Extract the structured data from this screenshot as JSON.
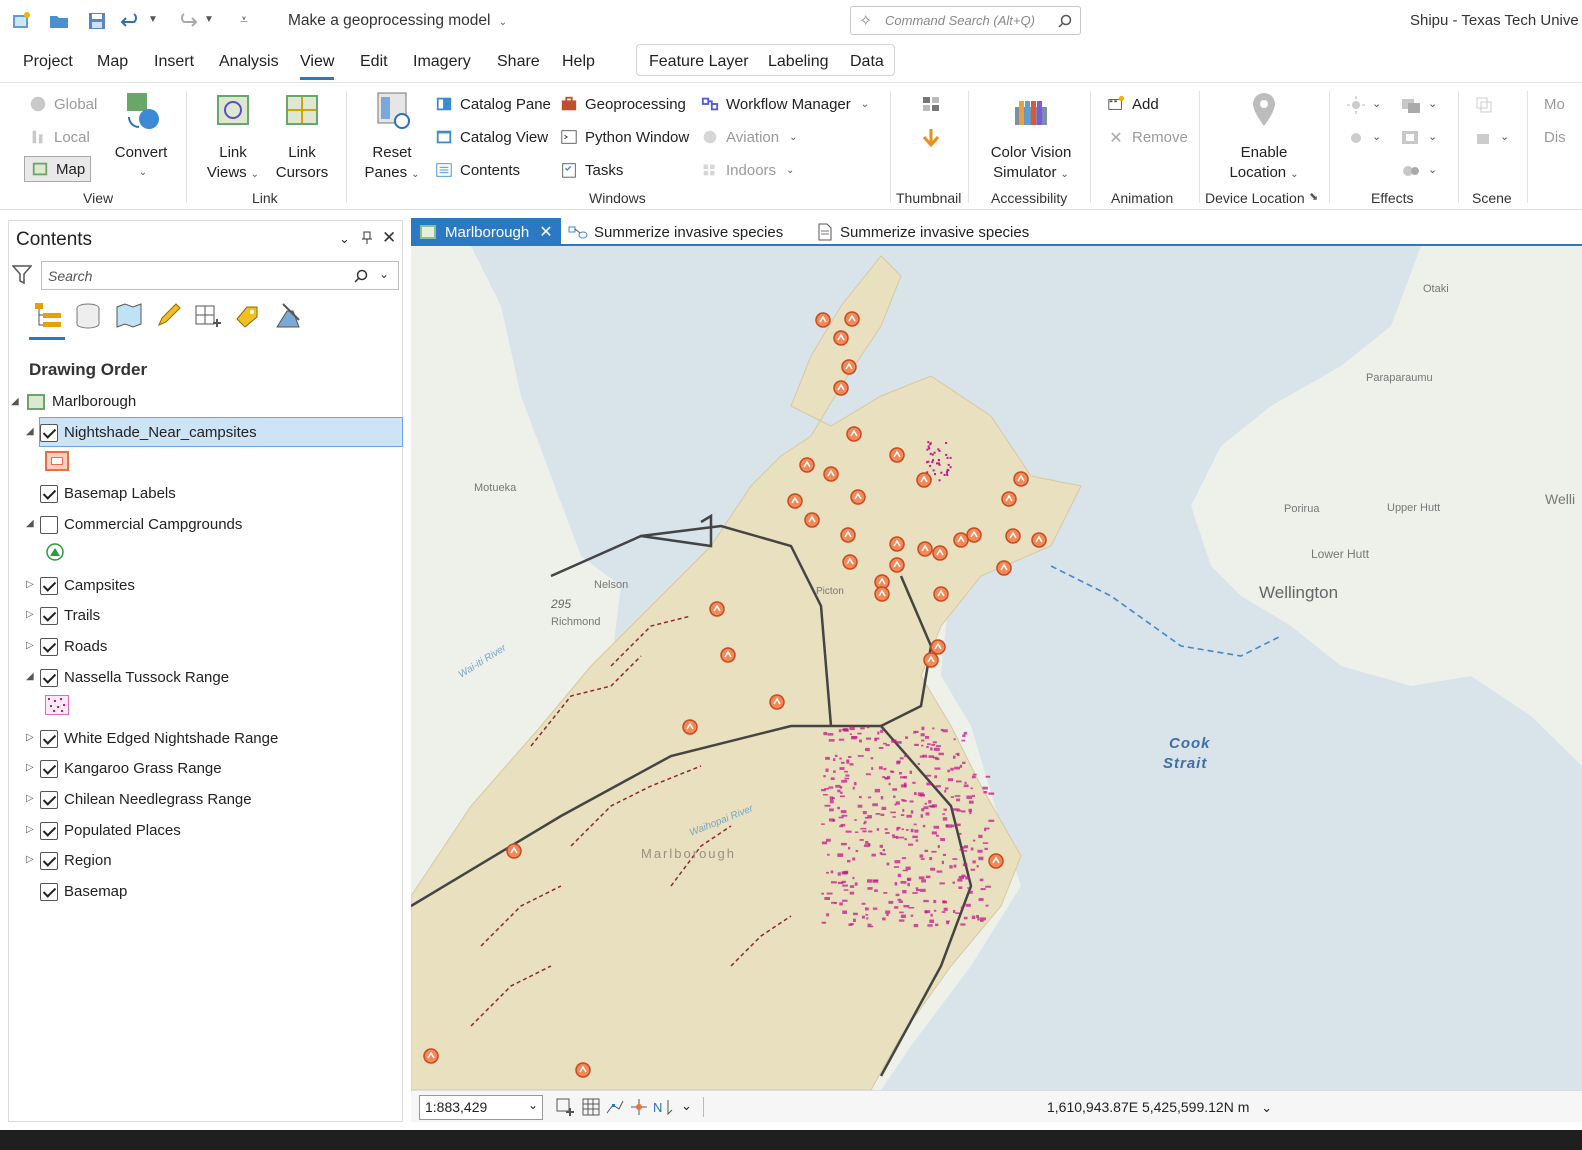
{
  "titlebar": {
    "doc_title": "Make a geoprocessing model",
    "command_search_placeholder": "Command Search (Alt+Q)",
    "user": "Shipu - Texas Tech Unive"
  },
  "menu": {
    "tabs": [
      "Project",
      "Map",
      "Insert",
      "Analysis",
      "View",
      "Edit",
      "Imagery",
      "Share",
      "Help"
    ],
    "active_tab": "View",
    "contextual_tabs": [
      "Feature Layer",
      "Labeling",
      "Data"
    ]
  },
  "ribbon": {
    "view_group": {
      "global": "Global",
      "local": "Local",
      "map": "Map",
      "convert": "Convert",
      "label": "View"
    },
    "link_group": {
      "link_views_1": "Link",
      "link_views_2": "Views",
      "link_cursors_1": "Link",
      "link_cursors_2": "Cursors",
      "label": "Link"
    },
    "windows_group": {
      "reset_1": "Reset",
      "reset_2": "Panes",
      "catalog_pane": "Catalog Pane",
      "catalog_view": "Catalog View",
      "contents": "Contents",
      "geoprocessing": "Geoprocessing",
      "python_window": "Python Window",
      "tasks": "Tasks",
      "workflow_manager": "Workflow Manager",
      "aviation": "Aviation",
      "indoors": "Indoors",
      "label": "Windows"
    },
    "thumbnail_label": "Thumbnail",
    "accessibility": {
      "cvs_1": "Color Vision",
      "cvs_2": "Simulator",
      "label": "Accessibility"
    },
    "animation": {
      "add": "Add",
      "remove": "Remove",
      "label": "Animation"
    },
    "device_location": {
      "enable_1": "Enable",
      "enable_2": "Location",
      "label": "Device Location"
    },
    "effects_label": "Effects",
    "scene_label": "Scene",
    "scene_trunc_1": "Mo",
    "scene_trunc_2": "Dis"
  },
  "contents": {
    "title": "Contents",
    "search_placeholder": "Search",
    "drawing_order": "Drawing Order",
    "map_name": "Marlborough",
    "layers": [
      {
        "name": "Nightshade_Near_campsites",
        "checked": true
      },
      {
        "name": "Basemap Labels",
        "checked": true
      },
      {
        "name": "Commercial Campgrounds",
        "checked": false
      },
      {
        "name": "Campsites",
        "checked": true
      },
      {
        "name": "Trails",
        "checked": true
      },
      {
        "name": "Roads",
        "checked": true
      },
      {
        "name": "Nassella Tussock Range",
        "checked": true
      },
      {
        "name": "White Edged Nightshade Range",
        "checked": true
      },
      {
        "name": "Kangaroo Grass Range",
        "checked": true
      },
      {
        "name": "Chilean Needlegrass Range",
        "checked": true
      },
      {
        "name": "Populated Places",
        "checked": true
      },
      {
        "name": "Region",
        "checked": true
      },
      {
        "name": "Basemap",
        "checked": true
      }
    ]
  },
  "view_tabs": [
    "Marlborough",
    "Summerize invasive species",
    "Summerize invasive species"
  ],
  "map": {
    "labels": {
      "otaki": "Otaki",
      "paraparaumu": "Paraparaumu",
      "motueka": "Motueka",
      "porirua": "Porirua",
      "upper_hutt": "Upper Hutt",
      "lower_hutt": "Lower Hutt",
      "wellington": "Wellington",
      "welli": "Welli",
      "nelson": "Nelson",
      "richmond": "Richmond",
      "road_295": "295",
      "wairau": "Wai-iti River",
      "marlborough": "Marlborough",
      "cook": "Cook",
      "strait": "Strait",
      "waihopai": "Waihopai River",
      "picton": "Picton"
    },
    "colors": {
      "sea": "#d9e3ea",
      "land": "#eef0ea",
      "region": "#e9e0c0",
      "campsite": "#e8703a",
      "road": "#444444",
      "trail": "#8a2a2a",
      "species": "#c2188a"
    }
  },
  "status": {
    "scale": "1:883,429",
    "coords": "1,610,943.87E 5,425,599.12N m"
  }
}
